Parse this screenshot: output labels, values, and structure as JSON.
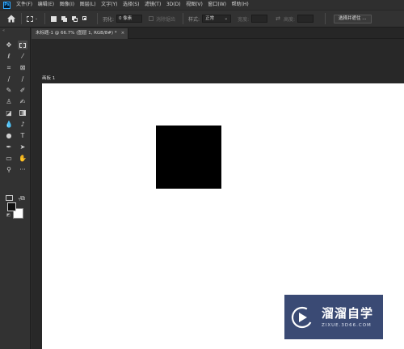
{
  "app": {
    "logo_text": "Ps"
  },
  "menu": {
    "items": [
      "文件(F)",
      "编辑(E)",
      "图像(I)",
      "图层(L)",
      "文字(Y)",
      "选择(S)",
      "滤镜(T)",
      "3D(D)",
      "视图(V)",
      "窗口(W)",
      "帮助(H)"
    ]
  },
  "options": {
    "feather_label": "羽化:",
    "feather_value": "0 像素",
    "antialias_label": "消除锯齿",
    "style_label": "样式:",
    "style_value": "正常",
    "width_label": "宽度:",
    "height_label": "高度:",
    "select_mask_label": "选择并遮住 ..."
  },
  "document": {
    "tab_title": "未标题-1 @ 66.7% (图层 1, RGB/8#) *",
    "tab_close": "×",
    "artboard_label": "画板 1"
  },
  "toolbar": {
    "collapse": "«",
    "more": "···"
  },
  "watermark": {
    "title": "溜溜自学",
    "url": "ZIXUE.3D66.COM"
  },
  "colors": {
    "foreground": "#111111",
    "background": "#ffffff",
    "accent": "#31a8ff",
    "watermark_bg": "#3a4a74"
  },
  "icons": [
    "home-icon",
    "move-tool-icon",
    "marquee-tool-icon",
    "lasso-tool-icon",
    "magic-wand-icon",
    "crop-tool-icon",
    "eyedropper-icon",
    "healing-brush-icon",
    "brush-tool-icon",
    "clone-stamp-icon",
    "history-brush-icon",
    "eraser-icon",
    "gradient-icon",
    "blur-icon",
    "dodge-icon",
    "pen-tool-icon",
    "type-tool-icon",
    "path-selection-icon",
    "rectangle-tool-icon",
    "hand-tool-icon",
    "zoom-tool-icon",
    "more-tools-icon",
    "quick-mask-icon",
    "screen-mode-icon"
  ]
}
